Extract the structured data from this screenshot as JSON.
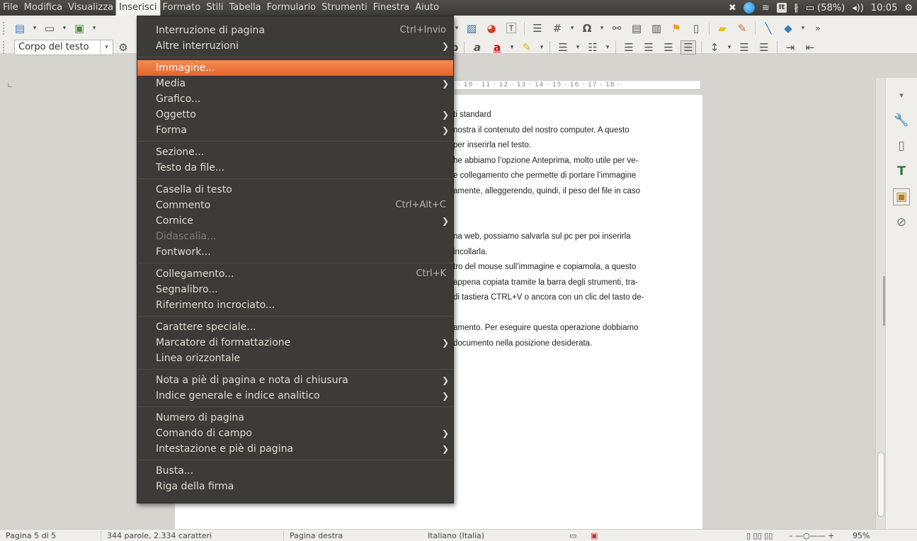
{
  "menubar": {
    "items": [
      "File",
      "Modifica",
      "Visualizza",
      "Inserisci",
      "Formato",
      "Stili",
      "Tabella",
      "Formulario",
      "Strumenti",
      "Finestra",
      "Aiuto"
    ],
    "active_index": 3
  },
  "tray": {
    "keyboard": "It",
    "battery": "(58%)",
    "clock": "10:05"
  },
  "toolbar": {
    "paragraph_style": "Corpo del testo"
  },
  "document": {
    "ruler": "· 10 · 11 · 12 · 13 · 14 · 15 · 16 · 17 · 18 ·",
    "lines": [
      "ti standard",
      "nostra il contenuto del nostro computer. A questo",
      "per inserirla nel testo.",
      "he abbiamo l’opzione Anteprima, molto utile per ve-",
      "e collegamento che permette di portare l’immagine",
      "amente, alleggerendo, quindi, il peso del file in caso",
      "",
      "",
      "na web, possiamo salvarla sul pc per poi inserirla",
      "incollarla.",
      "tro del mouse sull’immagine e copiamola, a questo",
      "appena copiata tramite la barra degli strumenti, tra-",
      "di tastiera CTRL+V o ancora con un clic del tasto de-",
      "",
      "amento. Per eseguire questa operazione dobbiamo",
      "documento nella posizione desiderata."
    ]
  },
  "menu": {
    "items": [
      {
        "label": "Interruzione di pagina",
        "shortcut": "Ctrl+Invio",
        "submenu": false,
        "sep_after": false
      },
      {
        "label": "Altre interruzioni",
        "shortcut": "",
        "submenu": true,
        "sep_after": true
      },
      {
        "label": "Immagine...",
        "shortcut": "",
        "submenu": false,
        "sep_after": false,
        "highlight": true
      },
      {
        "label": "Media",
        "shortcut": "",
        "submenu": true,
        "sep_after": false
      },
      {
        "label": "Grafico...",
        "shortcut": "",
        "submenu": false,
        "sep_after": false
      },
      {
        "label": "Oggetto",
        "shortcut": "",
        "submenu": true,
        "sep_after": false
      },
      {
        "label": "Forma",
        "shortcut": "",
        "submenu": true,
        "sep_after": true
      },
      {
        "label": "Sezione...",
        "shortcut": "",
        "submenu": false,
        "sep_after": false
      },
      {
        "label": "Testo da file...",
        "shortcut": "",
        "submenu": false,
        "sep_after": true
      },
      {
        "label": "Casella di testo",
        "shortcut": "",
        "submenu": false,
        "sep_after": false
      },
      {
        "label": "Commento",
        "shortcut": "Ctrl+Alt+C",
        "submenu": false,
        "sep_after": false
      },
      {
        "label": "Cornice",
        "shortcut": "",
        "submenu": true,
        "sep_after": false
      },
      {
        "label": "Didascalia...",
        "shortcut": "",
        "submenu": false,
        "sep_after": false,
        "disabled": true
      },
      {
        "label": "Fontwork...",
        "shortcut": "",
        "submenu": false,
        "sep_after": true
      },
      {
        "label": "Collegamento...",
        "shortcut": "Ctrl+K",
        "submenu": false,
        "sep_after": false
      },
      {
        "label": "Segnalibro...",
        "shortcut": "",
        "submenu": false,
        "sep_after": false
      },
      {
        "label": "Riferimento incrociato...",
        "shortcut": "",
        "submenu": false,
        "sep_after": true
      },
      {
        "label": "Carattere speciale...",
        "shortcut": "",
        "submenu": false,
        "sep_after": false
      },
      {
        "label": "Marcatore di formattazione",
        "shortcut": "",
        "submenu": true,
        "sep_after": false
      },
      {
        "label": "Linea orizzontale",
        "shortcut": "",
        "submenu": false,
        "sep_after": true
      },
      {
        "label": "Nota a piè di pagina e nota di chiusura",
        "shortcut": "",
        "submenu": true,
        "sep_after": false
      },
      {
        "label": "Indice generale e indice analitico",
        "shortcut": "",
        "submenu": true,
        "sep_after": true
      },
      {
        "label": "Numero di pagina",
        "shortcut": "",
        "submenu": false,
        "sep_after": false
      },
      {
        "label": "Comando di campo",
        "shortcut": "",
        "submenu": true,
        "sep_after": false
      },
      {
        "label": "Intestazione e piè di pagina",
        "shortcut": "",
        "submenu": true,
        "sep_after": true
      },
      {
        "label": "Busta...",
        "shortcut": "",
        "submenu": false,
        "sep_after": false
      },
      {
        "label": "Riga della firma",
        "shortcut": "",
        "submenu": false,
        "sep_after": false
      }
    ]
  },
  "statusbar": {
    "page": "Pagina 5 di 5",
    "words": "344 parole, 2.334 caratteri",
    "page_style": "Pagina destra",
    "language": "Italiano (Italia)",
    "zoom": "95%"
  },
  "colors": {
    "menu_bg": "#3c3b37",
    "highlight": "#e6642b"
  }
}
